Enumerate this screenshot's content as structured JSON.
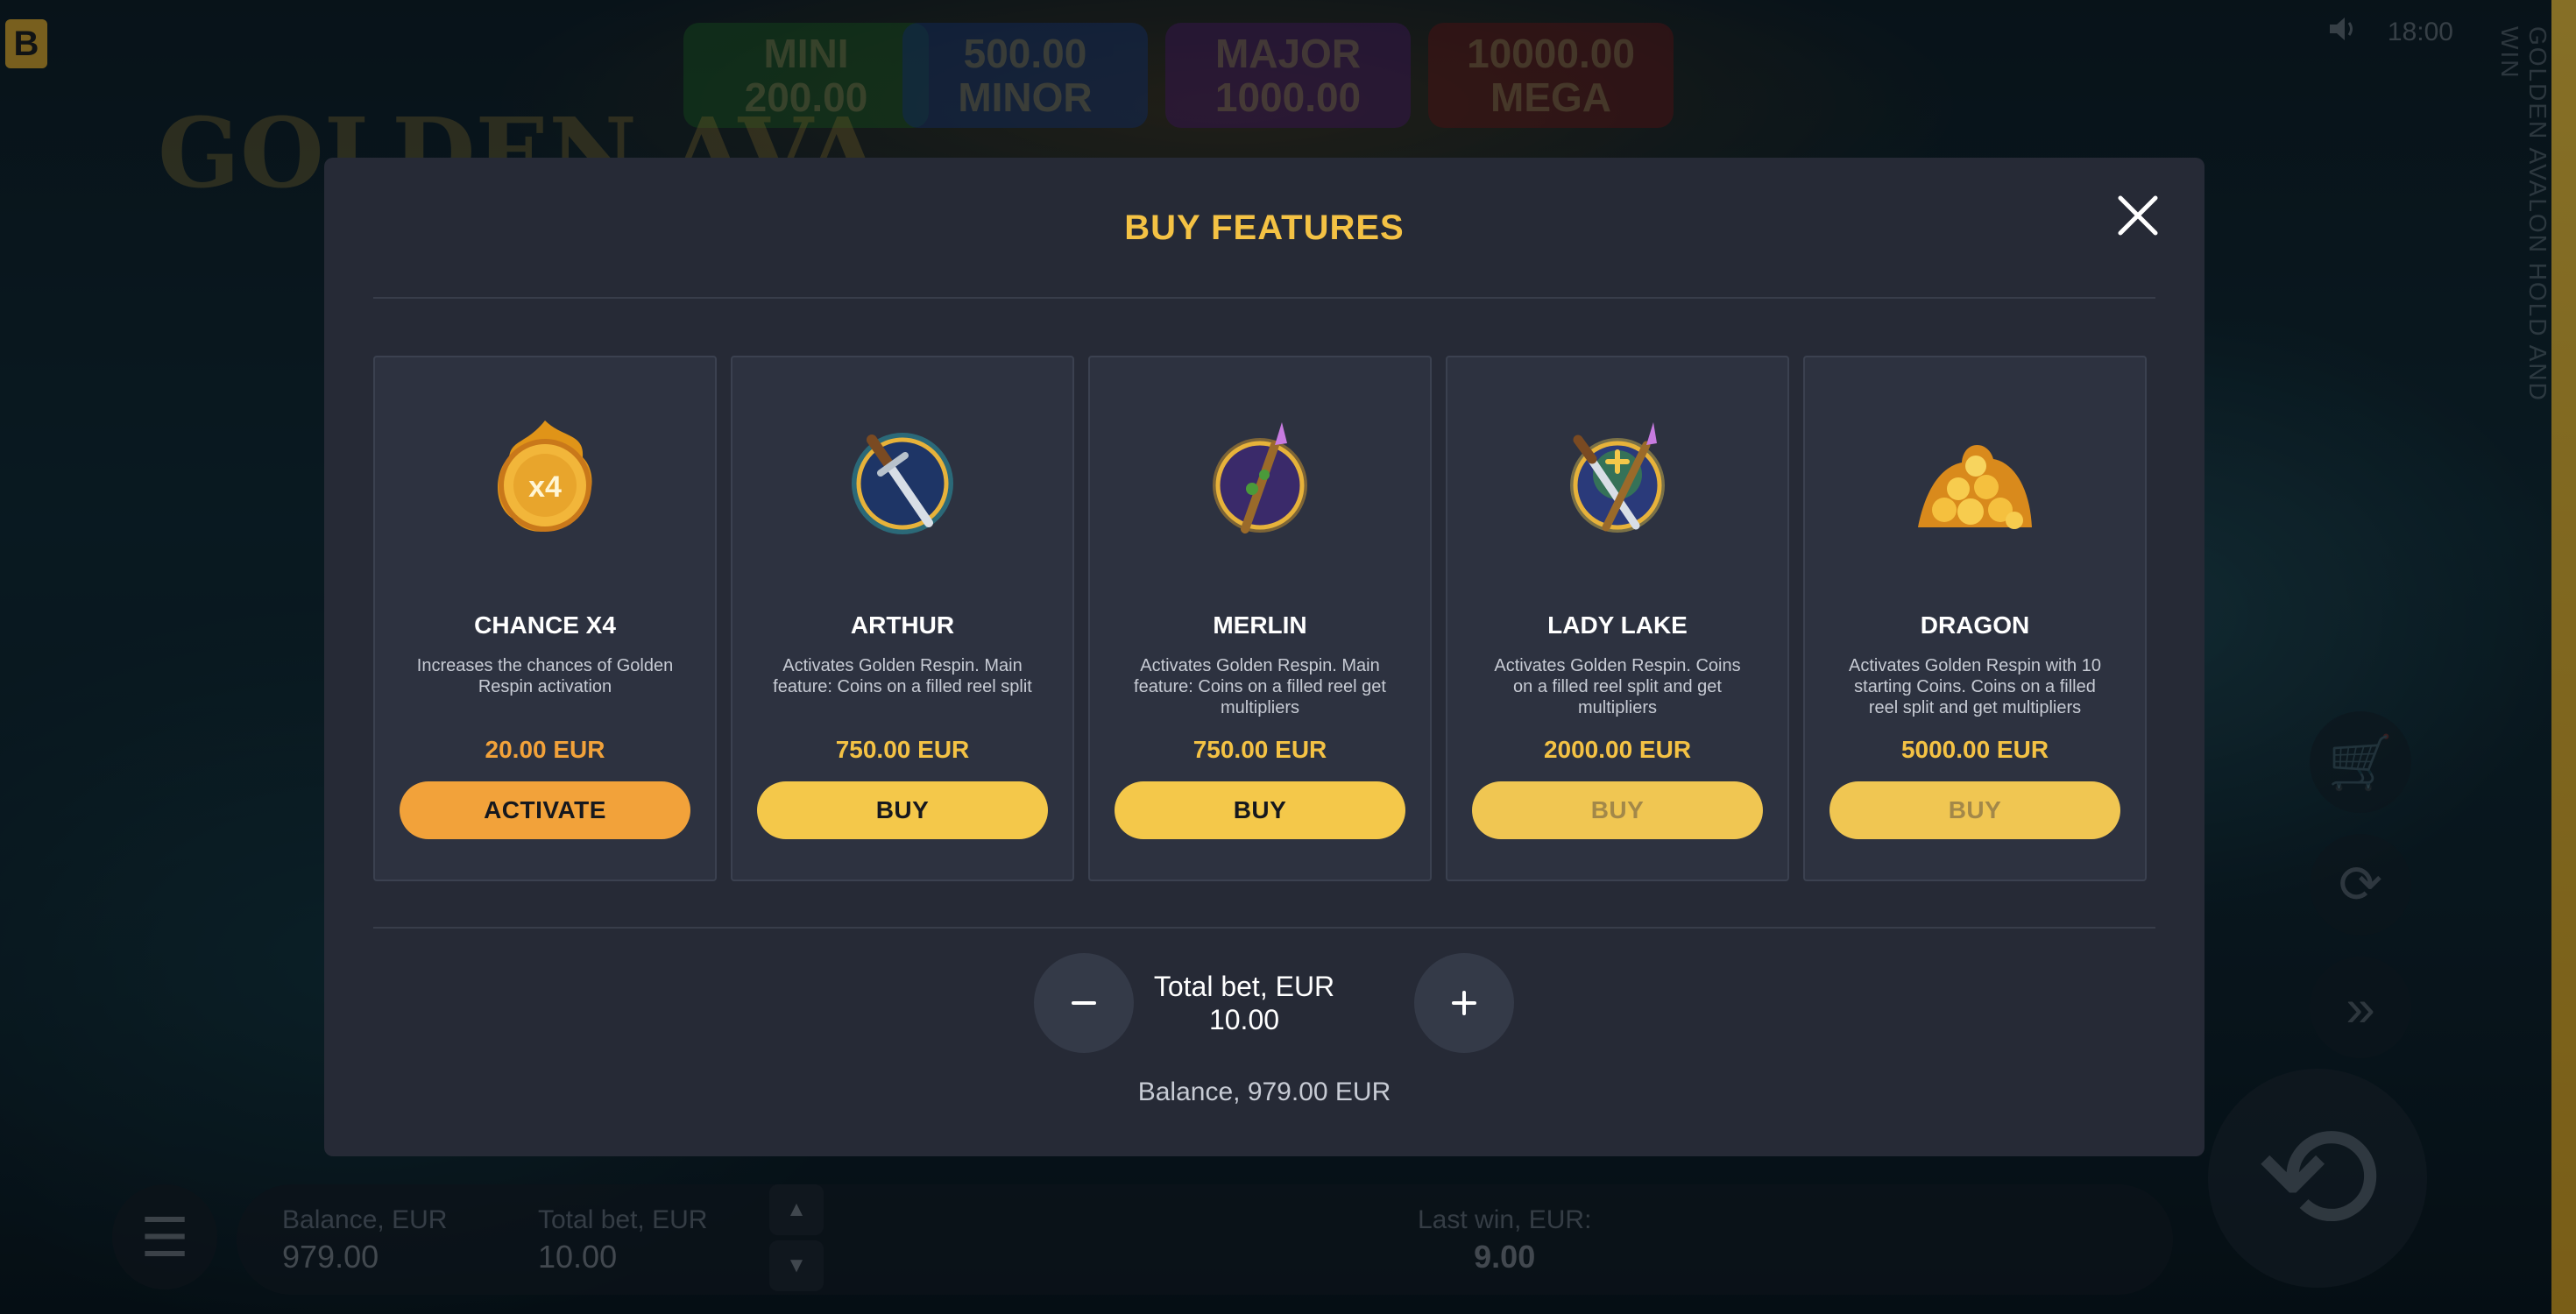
{
  "background": {
    "brand_logo": "B",
    "jackpots": [
      {
        "name": "MINI",
        "value": "200.00"
      },
      {
        "name": "MINOR",
        "value": "500.00"
      },
      {
        "name": "MAJOR",
        "value": "1000.00"
      },
      {
        "name": "MEGA",
        "value": "10000.00"
      }
    ],
    "game_logo": "GOLDEN AVA",
    "vertical_title": "GOLDEN AVALON HOLD AND WIN",
    "clock": "18:00",
    "balance_label": "Balance, EUR",
    "balance_value": "979.00",
    "total_bet_label": "Total bet, EUR",
    "total_bet_value": "10.00",
    "last_win_label": "Last win, EUR:",
    "last_win_value": "9.00",
    "icons": [
      "speaker-icon",
      "cart-icon",
      "autoplay-icon",
      "turbo-icon",
      "spin-icon",
      "menu-icon"
    ]
  },
  "modal": {
    "title": "BUY FEATURES",
    "features": [
      {
        "name": "CHANCE X4",
        "description": "Increases the chances of Golden Respin activation",
        "price": "20.00 EUR",
        "button": "ACTIVATE",
        "state": "activate",
        "icon": "coin-x4-icon"
      },
      {
        "name": "ARTHUR",
        "description": "Activates Golden Respin. Main feature: Coins on a filled reel split",
        "price": "750.00 EUR",
        "button": "BUY",
        "state": "enabled",
        "icon": "sword-icon"
      },
      {
        "name": "MERLIN",
        "description": "Activates Golden Respin. Main feature: Coins on a filled reel get multipliers",
        "price": "750.00 EUR",
        "button": "BUY",
        "state": "enabled",
        "icon": "staff-icon"
      },
      {
        "name": "LADY LAKE",
        "description": "Activates Golden Respin. Coins on a filled reel split and get multipliers",
        "price": "2000.00 EUR",
        "button": "BUY",
        "state": "disabled",
        "icon": "sword-and-staff-icon"
      },
      {
        "name": "DRAGON",
        "description": "Activates Golden Respin with 10 starting Coins. Coins on a filled reel split and get multipliers",
        "price": "5000.00 EUR",
        "button": "BUY",
        "state": "disabled",
        "icon": "gold-coins-icon"
      }
    ],
    "total_bet_label": "Total bet, EUR",
    "total_bet_value": "10.00",
    "balance": "Balance, 979.00 EUR",
    "colors": {
      "accent": "#f4c244",
      "activate": "#f2a23a",
      "panel": "#262a36",
      "card": "#2d3240"
    }
  }
}
